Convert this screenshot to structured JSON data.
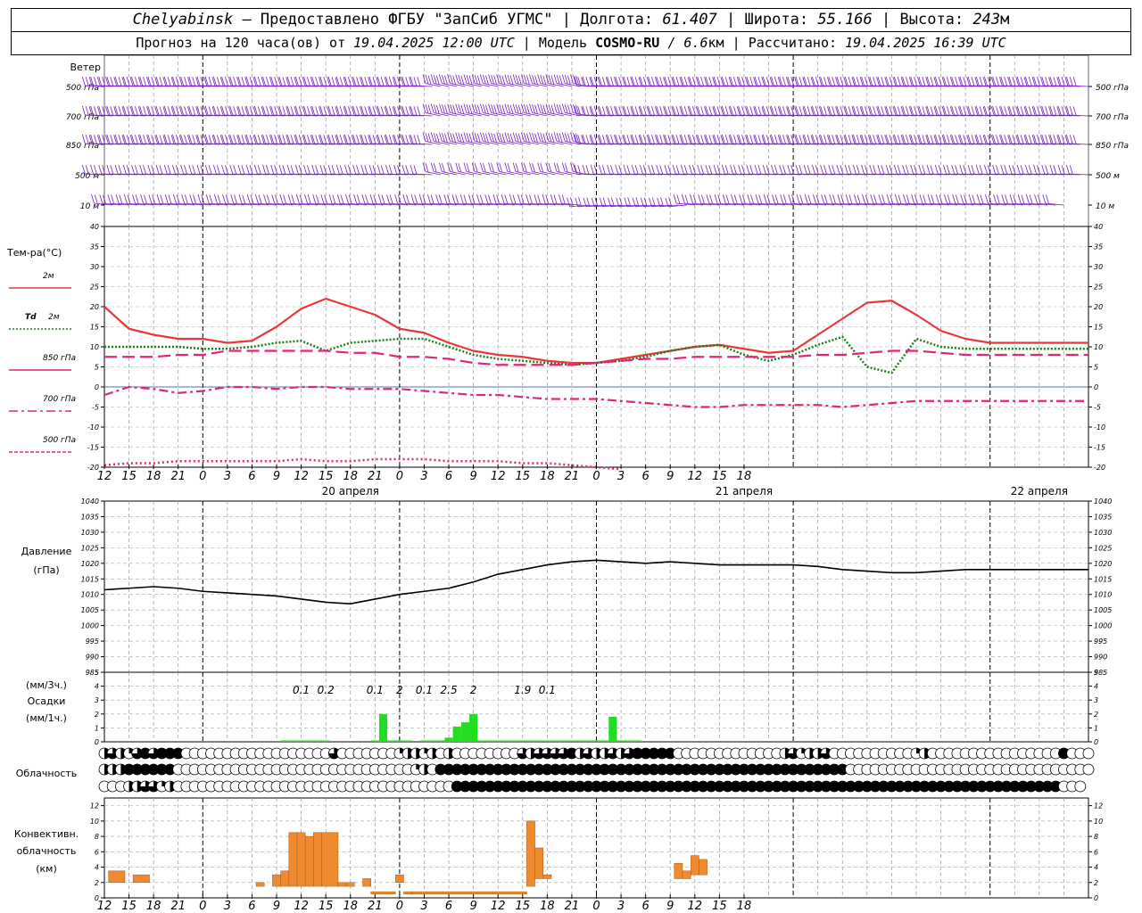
{
  "header": {
    "city": "Chelyabinsk",
    "provider": "— Предоставлено ФГБУ \"ЗапСиб УГМС\"",
    "lon_label": "Долгота:",
    "lon": "61.407",
    "lat_label": "Широта:",
    "lat": "55.166",
    "alt_label": "Высота:",
    "alt": "243",
    "alt_unit": "м",
    "forecast_text": "Прогноз на 120 часа(ов) от",
    "forecast_time": "19.04.2025 12:00 UTC",
    "model_label": "Модель",
    "model": "COSMO-RU",
    "model_res": "/ 6.6",
    "model_res_unit": "км",
    "computed_label": "Рассчитано:",
    "computed_time": "19.04.2025 16:39 UTC"
  },
  "colors": {
    "t2m": "#e8383a",
    "td2m": "#1e7d1e",
    "t850": "#e0257a",
    "t700": "#e0257a",
    "t500": "#e0257a",
    "wind": "#7a1fc8",
    "precip": "#22dd22",
    "convective": "#f08a30",
    "pressure": "#000000"
  },
  "wind": {
    "title": "Ветер",
    "levels": [
      "500 гПа",
      "700 гПа",
      "850 гПа",
      "500 м",
      "10 м"
    ]
  },
  "x_axis": {
    "hour_labels": [
      "12",
      "15",
      "18",
      "21",
      "0",
      "3",
      "6",
      "9",
      "12",
      "15",
      "18",
      "21",
      "0",
      "3",
      "6",
      "9",
      "12",
      "15",
      "18",
      "21",
      "0",
      "3",
      "6",
      "9",
      "12",
      "15",
      "18"
    ],
    "dates": [
      "20 апреля",
      "21 апреля",
      "22 апреля"
    ]
  },
  "chart_data": [
    {
      "type": "line",
      "title": "Тем-ра(°С)",
      "y_ticks": [
        40,
        35,
        30,
        25,
        20,
        15,
        10,
        5,
        0,
        -5,
        -10,
        -15,
        -20
      ],
      "ylim": [
        -20,
        40
      ],
      "x_hours": [
        0,
        3,
        6,
        9,
        12,
        15,
        18,
        21,
        24,
        27,
        30,
        33,
        36,
        39,
        42,
        45,
        48,
        51,
        54,
        57,
        60,
        63,
        66,
        69,
        72,
        75,
        78,
        81,
        84,
        87,
        90,
        93,
        96,
        99,
        102,
        105,
        108,
        111,
        114,
        117,
        120
      ],
      "series": [
        {
          "name": "2м",
          "style": "solid",
          "values": [
            20,
            14.5,
            13,
            12,
            12,
            11,
            11.5,
            15,
            19.5,
            22,
            20,
            18,
            14.5,
            13.5,
            11,
            9,
            8,
            7.5,
            6.5,
            6,
            6,
            7,
            8,
            9,
            10,
            10.5,
            9.5,
            8.5,
            9,
            13,
            17,
            21,
            21.5,
            18,
            14,
            12,
            11,
            11,
            11,
            11,
            11
          ]
        },
        {
          "name": "Td 2м",
          "style": "dotted",
          "values": [
            10,
            10,
            10,
            10,
            9.5,
            9.5,
            10,
            11,
            11.5,
            9,
            11,
            11.5,
            12,
            12,
            10,
            8,
            7,
            6.5,
            6,
            5.5,
            6,
            6.5,
            7.5,
            9,
            10,
            10.5,
            8,
            6.5,
            8,
            10.5,
            12.5,
            5,
            3.5,
            12,
            10,
            9.5,
            9.5,
            9.5,
            9.5,
            9.5,
            9.5
          ]
        },
        {
          "name": "850 гПа",
          "style": "long-dash",
          "values": [
            7.5,
            7.5,
            7.5,
            8,
            8,
            9,
            9,
            9,
            9,
            9,
            8.5,
            8.5,
            7.5,
            7.5,
            7,
            6,
            5.5,
            5.5,
            5.5,
            5.5,
            6,
            6.5,
            7,
            7,
            7.5,
            7.5,
            7.5,
            7.5,
            7.5,
            8,
            8,
            8.5,
            9,
            9,
            8.5,
            8,
            8,
            8,
            8,
            8,
            8
          ]
        },
        {
          "name": "700 гПа",
          "style": "dash-dot",
          "values": [
            -2,
            0,
            -0.5,
            -1.5,
            -1,
            0,
            0,
            -0.5,
            0,
            0,
            -0.5,
            -0.5,
            -0.5,
            -1,
            -1.5,
            -2,
            -2,
            -2.5,
            -3,
            -3,
            -3,
            -3.5,
            -4,
            -4.5,
            -5,
            -5,
            -4.5,
            -4.5,
            -4.5,
            -4.5,
            -5,
            -4.5,
            -4,
            -3.5,
            -3.5,
            -3.5,
            -3.5,
            -3.5,
            -3.5,
            -3.5,
            -3.5
          ]
        },
        {
          "name": "500 гПа",
          "style": "dotted-thick",
          "values": [
            -19.5,
            -19,
            -19,
            -18.5,
            -18.5,
            -18.5,
            -18.5,
            -18.5,
            -18,
            -18.5,
            -18.5,
            -18,
            -18,
            -18,
            -18.5,
            -18.5,
            -18.5,
            -19,
            -19,
            -19.5,
            -20,
            -20.5
          ]
        }
      ]
    },
    {
      "type": "line",
      "title": "Давление (гПа)",
      "y_ticks": [
        1040,
        1035,
        1030,
        1025,
        1020,
        1015,
        1010,
        1005,
        1000,
        995,
        990,
        985
      ],
      "ylim": [
        985,
        1040
      ],
      "x_hours": [
        0,
        3,
        6,
        9,
        12,
        15,
        18,
        21,
        24,
        27,
        30,
        33,
        36,
        39,
        42,
        45,
        48,
        51,
        54,
        57,
        60,
        63,
        66,
        69,
        72,
        75,
        78,
        81,
        84,
        87,
        90,
        93,
        96,
        99,
        102,
        105,
        108,
        111,
        114,
        117,
        120
      ],
      "series": [
        {
          "name": "Давление",
          "values": [
            1011.5,
            1012,
            1012.5,
            1012,
            1011,
            1010.5,
            1010,
            1009.5,
            1008.5,
            1007.5,
            1007,
            1008.5,
            1010,
            1011,
            1012,
            1014,
            1016.5,
            1018,
            1019.5,
            1020.5,
            1021,
            1020.5,
            1020,
            1020.5,
            1020,
            1019.5,
            1019.5,
            1019.5,
            1019.5,
            1019,
            1018,
            1017.5,
            1017,
            1017,
            1017.5,
            1018,
            1018,
            1018,
            1018,
            1018,
            1018
          ]
        }
      ]
    },
    {
      "type": "bar",
      "title": "Осадки",
      "y_unit_top": "(мм/3ч.)",
      "y_unit_bottom": "(мм/1ч.)",
      "y_ticks": [
        5,
        4,
        3,
        2,
        1,
        0
      ],
      "ylim": [
        0,
        5
      ],
      "bar_hours": [
        22,
        23,
        24,
        25,
        26,
        27,
        33,
        34,
        35,
        36,
        37,
        39,
        40,
        41,
        42,
        43,
        44,
        45,
        46,
        47,
        48,
        49,
        50,
        51,
        52,
        53,
        54,
        55,
        56,
        57,
        58,
        59,
        60,
        61,
        62,
        63,
        64,
        65
      ],
      "values": [
        0.1,
        0.1,
        0.1,
        0.1,
        0.1,
        0.1,
        0.1,
        2.0,
        0.1,
        0.1,
        0.1,
        0.1,
        0.1,
        0.1,
        0.3,
        1.1,
        1.4,
        2.0,
        0.1,
        0.1,
        0.1,
        0.1,
        0.1,
        0.1,
        0.1,
        0.1,
        0.1,
        0.1,
        0.1,
        0.1,
        0.1,
        0.1,
        0.1,
        0.1,
        1.8,
        0.1,
        0.1,
        0.1
      ],
      "accumulated_labels": [
        {
          "hour": 24,
          "text": "0.1"
        },
        {
          "hour": 27,
          "text": "0.2"
        },
        {
          "hour": 33,
          "text": "0.1"
        },
        {
          "hour": 36,
          "text": "2"
        },
        {
          "hour": 39,
          "text": "0.1"
        },
        {
          "hour": 42,
          "text": "2.5"
        },
        {
          "hour": 45,
          "text": "2"
        },
        {
          "hour": 51,
          "text": "1.9"
        },
        {
          "hour": 54,
          "text": "0.1"
        }
      ]
    },
    {
      "type": "bar",
      "title": "Конвективн. облачность (км)",
      "y_ticks": [
        12,
        10,
        8,
        6,
        4,
        2,
        0
      ],
      "ylim": [
        0,
        13
      ],
      "bars": [
        {
          "x0": 0.5,
          "x1": 2.5,
          "bottom": 2,
          "top": 3.5
        },
        {
          "x0": 3.5,
          "x1": 5.5,
          "bottom": 2,
          "top": 3
        },
        {
          "x0": 18.5,
          "x1": 19.5,
          "bottom": 1.5,
          "top": 2
        },
        {
          "x0": 20.5,
          "x1": 21.5,
          "bottom": 1.5,
          "top": 3
        },
        {
          "x0": 21.5,
          "x1": 22.5,
          "bottom": 1.5,
          "top": 3.5
        },
        {
          "x0": 22.5,
          "x1": 23.5,
          "bottom": 1.5,
          "top": 8.5
        },
        {
          "x0": 23.5,
          "x1": 24.5,
          "bottom": 1.5,
          "top": 8.5
        },
        {
          "x0": 24.5,
          "x1": 25.5,
          "bottom": 1.5,
          "top": 8.0
        },
        {
          "x0": 25.5,
          "x1": 26.5,
          "bottom": 1.5,
          "top": 8.5
        },
        {
          "x0": 26.5,
          "x1": 28.5,
          "bottom": 1.5,
          "top": 8.5
        },
        {
          "x0": 28.5,
          "x1": 29.5,
          "bottom": 1.5,
          "top": 2.0
        },
        {
          "x0": 29.5,
          "x1": 30.5,
          "bottom": 1.5,
          "top": 2.0
        },
        {
          "x0": 31.5,
          "x1": 32.5,
          "bottom": 1.5,
          "top": 2.5
        },
        {
          "x0": 32.5,
          "x1": 35.5,
          "bottom": 0.5,
          "top": 0.8
        },
        {
          "x0": 35.5,
          "x1": 36.5,
          "bottom": 2.0,
          "top": 3.0
        },
        {
          "x0": 36.5,
          "x1": 37.5,
          "bottom": 0.5,
          "top": 0.8
        },
        {
          "x0": 37.5,
          "x1": 51.5,
          "bottom": 0.5,
          "top": 0.8
        },
        {
          "x0": 51.5,
          "x1": 52.5,
          "bottom": 1.5,
          "top": 10
        },
        {
          "x0": 52.5,
          "x1": 53.5,
          "bottom": 2.5,
          "top": 6.5
        },
        {
          "x0": 53.5,
          "x1": 54.5,
          "bottom": 2.5,
          "top": 3.0
        },
        {
          "x0": 69.5,
          "x1": 70.5,
          "bottom": 2.5,
          "top": 4.5
        },
        {
          "x0": 70.5,
          "x1": 71.5,
          "bottom": 2.5,
          "top": 3.5
        },
        {
          "x0": 71.5,
          "x1": 72.5,
          "bottom": 3.0,
          "top": 5.5
        },
        {
          "x0": 72.5,
          "x1": 73.5,
          "bottom": 3.0,
          "top": 5.0
        }
      ]
    }
  ],
  "cloud_panel": {
    "title": "Облачность",
    "rows": [
      "2321343444000000000000000000300000001221202000000003233334232232344444000000000000023122300000000001200000000000000004000",
      "2224444440000000000000000000000000000012044444444444444444444444444444444444444444444444444000000000000000000000000000000",
      "000223312000000000000000000000000000000000044444444444444444444444444444444444444444444444444444444444444444444444444000"
    ]
  },
  "panel_labels": {
    "temp_2m": "2м",
    "temp_td": "Td",
    "temp_td_2m": "2м",
    "temp_850": "850 гПа",
    "temp_700": "700 гПа",
    "temp_500": "500 гПа",
    "pressure_1": "Давление",
    "pressure_2": "(гПа)",
    "precip_1": "(мм/3ч.)",
    "precip_2": "Осадки",
    "precip_3": "(мм/1ч.)",
    "cloud": "Облачность",
    "conv_1": "Конвективн.",
    "conv_2": "облачность",
    "conv_3": "(км)"
  }
}
